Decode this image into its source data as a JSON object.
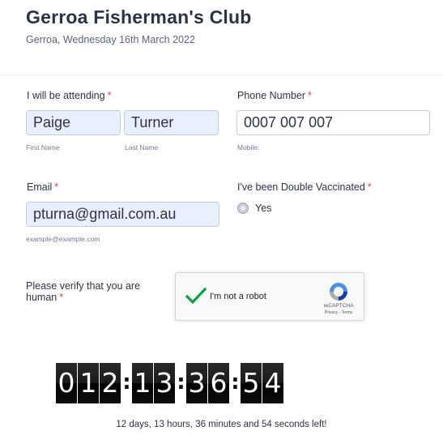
{
  "form": {
    "title": "Gerroa Fisherman's Club",
    "subtitle": "Gerroa, Wednesday 16th March 2022",
    "required_mark": "*"
  },
  "attending": {
    "label": "I will be attending",
    "first_name_value": "Paige",
    "last_name_value": "Turner",
    "first_name_sublabel": "First Name",
    "last_name_sublabel": "Last Name"
  },
  "phone": {
    "label": "Phone Number",
    "value": "0007 007 007",
    "sublabel": "Mobile:"
  },
  "email": {
    "label": "Email",
    "value": "pturna@gmail.com.au",
    "sublabel": "example@example.com"
  },
  "vaccination": {
    "label": "I've been Double Vaccinated",
    "option_label": "Yes",
    "option_selected": false
  },
  "verify": {
    "label": "Please verify that you are human"
  },
  "captcha": {
    "checkbox_label": "I'm not a robot",
    "brand": "reCAPTCHA",
    "links": "Privacy - Terms",
    "checked": true,
    "check_color": "#0a9f44"
  },
  "countdown": {
    "days": [
      "0",
      "1",
      "2"
    ],
    "hours": [
      "1",
      "3"
    ],
    "minutes": [
      "3",
      "6"
    ],
    "seconds": [
      "5",
      "4"
    ],
    "separator": ":",
    "summary": "12 days, 13 hours, 36 minutes and 54 seconds left!"
  },
  "colors": {
    "required": "#f23a3c",
    "autofill_background": "#e8f0fe",
    "text": "#2c3345"
  }
}
